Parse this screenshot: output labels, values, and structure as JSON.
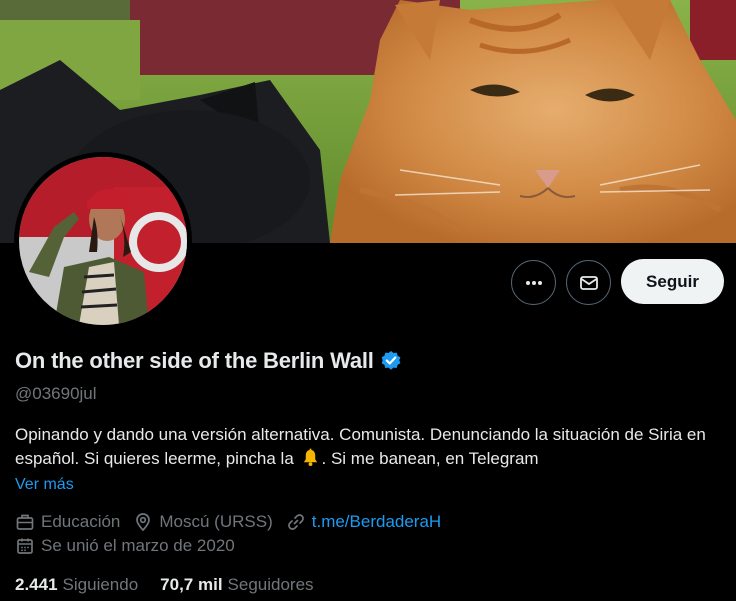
{
  "profile": {
    "display_name": "On the other side of the Berlin Wall",
    "verified": true,
    "handle": "@03690jul",
    "bio_part1": "Opinando y dando una versión alternativa. Comunista. Denunciando la situación de Siria en español. Si quieres leerme, pincha la",
    "bio_part2": ". Si me banean, en Telegram",
    "bio_emoji": "bell-icon",
    "see_more": "Ver más",
    "category": "Educación",
    "location": "Moscú (URSS)",
    "link": "t.me/BerdaderaH",
    "joined": "Se unió el marzo de 2020"
  },
  "stats": {
    "following_count": "2.441",
    "following_label": "Siguiendo",
    "followers_count": "70,7 mil",
    "followers_label": "Seguidores"
  },
  "actions": {
    "follow_label": "Seguir",
    "more_icon": "more-icon",
    "message_icon": "mail-icon"
  },
  "colors": {
    "background": "#000000",
    "accent": "#1d9bf0",
    "text_primary": "#e7e9ea",
    "text_secondary": "#71767b",
    "follow_bg": "#eff3f4"
  }
}
